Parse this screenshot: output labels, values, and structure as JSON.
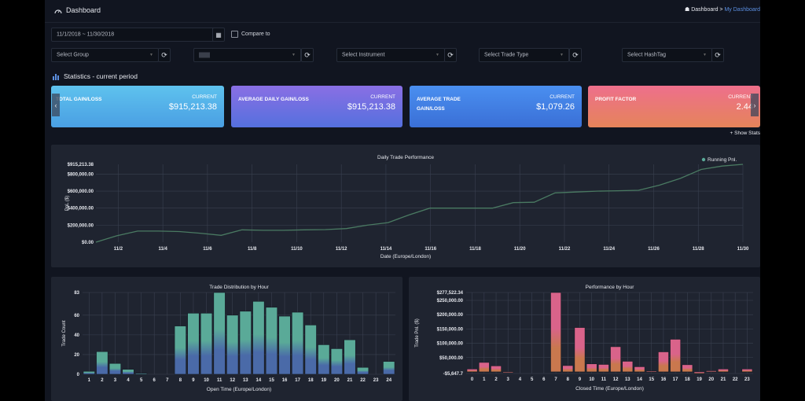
{
  "header": {
    "title": "Dashboard",
    "breadcrumb": {
      "home": "Dashboard",
      "separator": ">",
      "current": "My Dashboard"
    }
  },
  "filters": {
    "date_range": "11/1/2018 ~ 11/30/2018",
    "compare_label": "Compare to",
    "compare_checked": false,
    "group_placeholder": "Select Group",
    "account_value": "",
    "instrument_placeholder": "Select Instrument",
    "trade_type_placeholder": "Select Trade Type",
    "hashtag_placeholder": "Select HashTag"
  },
  "statistics": {
    "section_title": "Statistics - current period",
    "show_stats": "+ Show Stats",
    "cards": [
      {
        "label": "TOTAL GAIN/LOSS",
        "current_label": "CURRENT",
        "value": "$915,213.38",
        "color": "#5ec2ee"
      },
      {
        "label": "AVERAGE DAILY GAIN/LOSS",
        "current_label": "CURRENT",
        "value": "$915,213.38",
        "color": "#8a6fe4"
      },
      {
        "label": "AVERAGE TRADE GAIN/LOSS",
        "current_label": "CURRENT",
        "value": "$1,079.26",
        "color": "#4a8ff0"
      },
      {
        "label": "PROFIT FACTOR",
        "current_label": "CURRENT",
        "value": "2.44",
        "color": "#ee6f8c"
      }
    ]
  },
  "chart_data": [
    {
      "type": "line",
      "title": "Daily Trade Performance",
      "xlabel": "Date (Europe/London)",
      "ylabel": "PnL ($)",
      "legend": {
        "entries": [
          "Running Pnl."
        ],
        "placement": "top-right"
      },
      "ylim": [
        0,
        915213.38
      ],
      "yticks": [
        "$0.00",
        "$200,000.00",
        "$400,000.00",
        "$600,000.00",
        "$800,000.00",
        "$915,213.38"
      ],
      "ytick_values": [
        0,
        200000,
        400000,
        600000,
        800000,
        915213.38
      ],
      "xtick_labels": [
        "11/2",
        "11/4",
        "11/6",
        "11/8",
        "11/10",
        "11/12",
        "11/14",
        "11/16",
        "11/18",
        "11/20",
        "11/22",
        "11/24",
        "11/26",
        "11/28",
        "11/30"
      ],
      "x": [
        1,
        2,
        3,
        4,
        5,
        6,
        7,
        8,
        9,
        10,
        11,
        12,
        13,
        14,
        15,
        16,
        17,
        18,
        19,
        20,
        21,
        22,
        23,
        24,
        25,
        26,
        27,
        28,
        29,
        30
      ],
      "series": [
        {
          "name": "Running Pnl.",
          "color": "#4a7a62",
          "values": [
            0,
            75000,
            130000,
            130000,
            125000,
            105000,
            80000,
            145000,
            140000,
            140000,
            145000,
            148000,
            160000,
            200000,
            230000,
            320000,
            400000,
            400000,
            400000,
            400000,
            465000,
            470000,
            580000,
            590000,
            600000,
            605000,
            610000,
            670000,
            750000,
            855000,
            895000,
            915213.38
          ]
        }
      ],
      "grid": true
    },
    {
      "type": "bar",
      "title": "Trade Distribution by Hour",
      "xlabel": "Open Time (Europe/London)",
      "ylabel": "Trade Count",
      "ylim": [
        0,
        83
      ],
      "yticks": [
        0,
        20,
        40,
        60,
        83
      ],
      "categories": [
        "1",
        "2",
        "3",
        "4",
        "5",
        "6",
        "7",
        "8",
        "9",
        "10",
        "11",
        "12",
        "13",
        "14",
        "15",
        "16",
        "17",
        "18",
        "19",
        "20",
        "21",
        "22",
        "23",
        "24"
      ],
      "values": [
        3,
        23,
        11,
        5,
        1,
        0,
        0,
        49,
        62,
        62,
        83,
        60,
        64,
        74,
        68,
        59,
        63,
        50,
        30,
        26,
        35,
        7,
        0,
        13
      ],
      "colors": {
        "top": "#5aaa98",
        "bottom": "#4a6aa8"
      },
      "grid": true
    },
    {
      "type": "bar",
      "title": "Performance by Hour",
      "xlabel": "Closed Time (Europe/London)",
      "ylabel": "Trade Pnl. ($)",
      "ylim": [
        -5647.7,
        277522.34
      ],
      "yticks": [
        "-$5,647.7",
        "$50,000.00",
        "$100,000.00",
        "$150,000.00",
        "$200,000.00",
        "$250,000.00",
        "$277,522.34"
      ],
      "ytick_values": [
        -5647.7,
        50000,
        100000,
        150000,
        200000,
        250000,
        277522.34
      ],
      "categories": [
        "0",
        "1",
        "2",
        "3",
        "4",
        "5",
        "6",
        "7",
        "8",
        "9",
        "10",
        "11",
        "12",
        "13",
        "14",
        "15",
        "16",
        "17",
        "18",
        "19",
        "20",
        "21",
        "22",
        "23"
      ],
      "values": [
        10000,
        33000,
        21000,
        -3000,
        0,
        0,
        0,
        277522.34,
        22000,
        155000,
        28000,
        26000,
        88000,
        37000,
        18000,
        3000,
        70000,
        114000,
        25000,
        -5647.7,
        4000,
        10000,
        0,
        10000
      ],
      "colors": {
        "top": "#d9638a",
        "bottom": "#c9784e"
      },
      "grid": true
    }
  ]
}
